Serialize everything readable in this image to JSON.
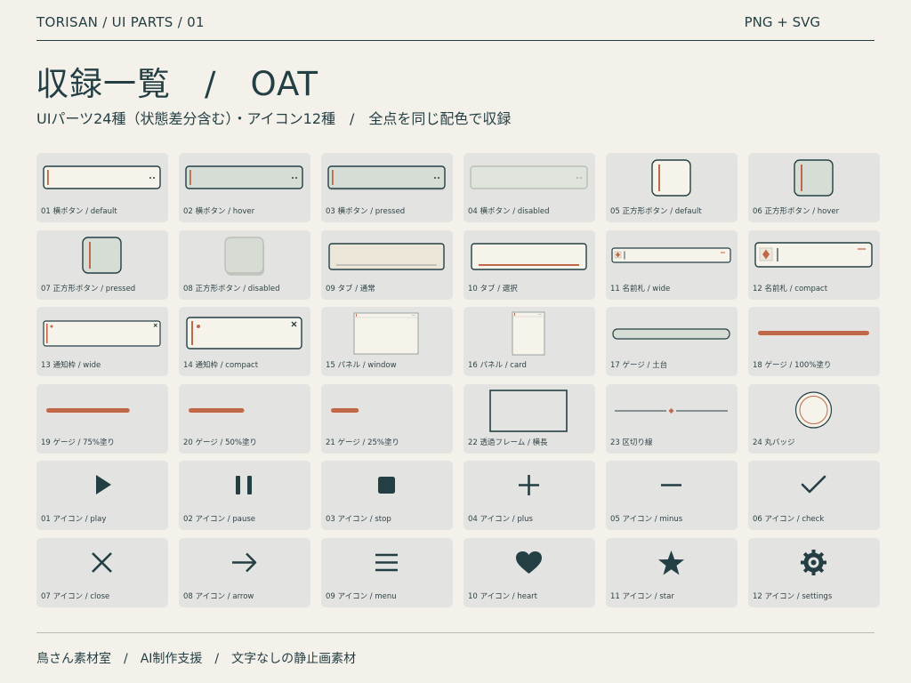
{
  "header": {
    "brand": "TORISAN / UI PARTS / 01",
    "format": "PNG + SVG"
  },
  "title": "収録一覧　/　OAT",
  "subtitle": "UIパーツ24種（状態差分含む）・アイコン12種　/　全点を同じ配色で収録",
  "colors": {
    "background": "#f3f1ea",
    "card": "#e3e4e1",
    "ink": "#243f44",
    "accent": "#c0694a",
    "cream": "#f6f3ea",
    "sage": "#d6ddd5"
  },
  "items": [
    {
      "label": "01 横ボタン / default",
      "kind": "hbutton-default"
    },
    {
      "label": "02 横ボタン / hover",
      "kind": "hbutton-hover"
    },
    {
      "label": "03 横ボタン / pressed",
      "kind": "hbutton-pressed"
    },
    {
      "label": "04 横ボタン / disabled",
      "kind": "hbutton-disabled"
    },
    {
      "label": "05 正方形ボタン / default",
      "kind": "sq-default"
    },
    {
      "label": "06 正方形ボタン / hover",
      "kind": "sq-hover"
    },
    {
      "label": "07 正方形ボタン / pressed",
      "kind": "sq-pressed"
    },
    {
      "label": "08 正方形ボタン / disabled",
      "kind": "sq-disabled"
    },
    {
      "label": "09 タブ / 通常",
      "kind": "tab-normal"
    },
    {
      "label": "10 タブ / 選択",
      "kind": "tab-selected"
    },
    {
      "label": "11 名前札 / wide",
      "kind": "nametag-wide"
    },
    {
      "label": "12 名前札 / compact",
      "kind": "nametag-compact"
    },
    {
      "label": "13 通知枠 / wide",
      "kind": "notice-wide"
    },
    {
      "label": "14 通知枠 / compact",
      "kind": "notice-compact"
    },
    {
      "label": "15 パネル / window",
      "kind": "panel-window"
    },
    {
      "label": "16 パネル / card",
      "kind": "panel-card"
    },
    {
      "label": "17 ゲージ / 土台",
      "kind": "gauge-base",
      "fill": 0
    },
    {
      "label": "18 ゲージ / 100%塗り",
      "kind": "gauge-fill",
      "fill": 1.0
    },
    {
      "label": "19 ゲージ / 75%塗り",
      "kind": "gauge-fill",
      "fill": 0.75
    },
    {
      "label": "20 ゲージ / 50%塗り",
      "kind": "gauge-fill",
      "fill": 0.5
    },
    {
      "label": "21 ゲージ / 25%塗り",
      "kind": "gauge-fill",
      "fill": 0.25
    },
    {
      "label": "22 透過フレーム / 横長",
      "kind": "frame"
    },
    {
      "label": "23 区切り線",
      "kind": "divider"
    },
    {
      "label": "24 丸バッジ",
      "kind": "badge"
    },
    {
      "label": "01 アイコン / play",
      "kind": "icon",
      "icon": "play-icon"
    },
    {
      "label": "02 アイコン / pause",
      "kind": "icon",
      "icon": "pause-icon"
    },
    {
      "label": "03 アイコン / stop",
      "kind": "icon",
      "icon": "stop-icon"
    },
    {
      "label": "04 アイコン / plus",
      "kind": "icon",
      "icon": "plus-icon"
    },
    {
      "label": "05 アイコン / minus",
      "kind": "icon",
      "icon": "minus-icon"
    },
    {
      "label": "06 アイコン / check",
      "kind": "icon",
      "icon": "check-icon"
    },
    {
      "label": "07 アイコン / close",
      "kind": "icon",
      "icon": "close-icon"
    },
    {
      "label": "08 アイコン / arrow",
      "kind": "icon",
      "icon": "arrow-icon"
    },
    {
      "label": "09 アイコン / menu",
      "kind": "icon",
      "icon": "menu-icon"
    },
    {
      "label": "10 アイコン / heart",
      "kind": "icon",
      "icon": "heart-icon"
    },
    {
      "label": "11 アイコン / star",
      "kind": "icon",
      "icon": "star-icon"
    },
    {
      "label": "12 アイコン / settings",
      "kind": "icon",
      "icon": "settings-icon"
    }
  ],
  "footer": "鳥さん素材室　/　AI制作支援　/　文字なしの静止画素材"
}
